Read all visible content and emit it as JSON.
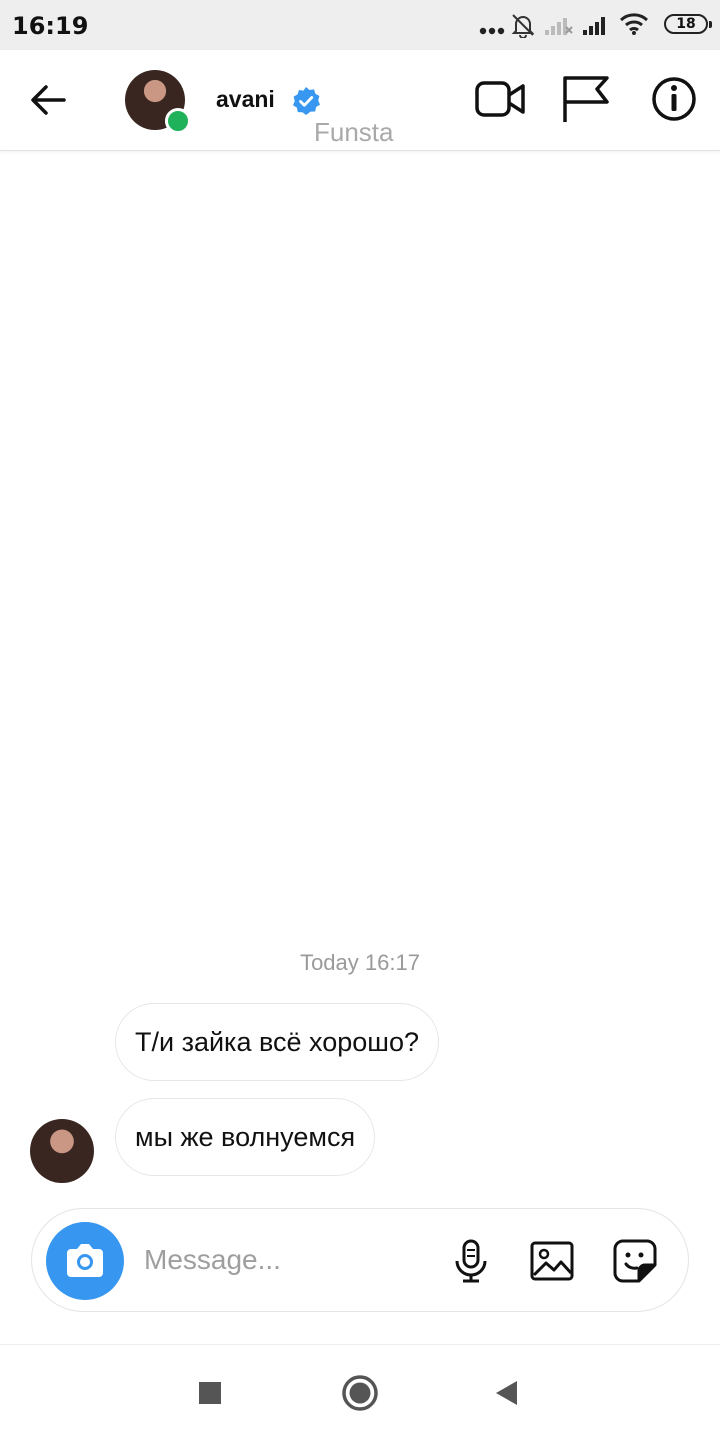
{
  "status_bar": {
    "time": "16:19",
    "battery": "18",
    "icons": [
      "dots-icon",
      "bell-muted-icon",
      "signal-weak-icon",
      "signal-icon",
      "wifi-icon",
      "battery-icon"
    ]
  },
  "header": {
    "username": "avani",
    "subtitle": "Funsta",
    "verified": true,
    "online": true,
    "icons": [
      "back-arrow-icon",
      "video-call-icon",
      "flag-icon",
      "info-icon"
    ]
  },
  "conversation": {
    "timestamp": "Today 16:17",
    "messages": [
      {
        "text": "Т/и зайка всё хорошо?"
      },
      {
        "text": "мы же волнуемся"
      }
    ]
  },
  "composer": {
    "placeholder": "Message...",
    "icons": [
      "camera-icon",
      "microphone-icon",
      "gallery-icon",
      "sticker-icon"
    ]
  },
  "navbar": {
    "icons": [
      "recents-square-icon",
      "home-circle-icon",
      "back-triangle-icon"
    ]
  },
  "colors": {
    "accent_blue": "#3797f0",
    "online_green": "#20b25a",
    "verified_blue": "#3897f0"
  }
}
